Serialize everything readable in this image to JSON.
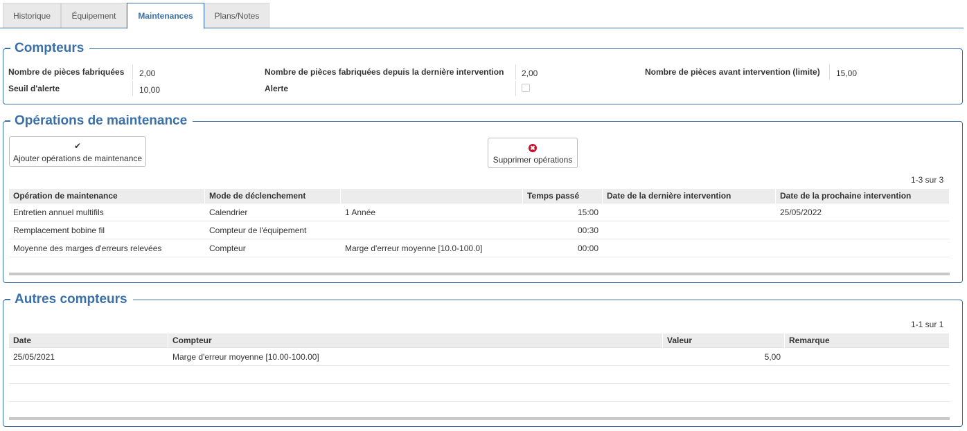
{
  "tabs": [
    {
      "label": "Historique"
    },
    {
      "label": "Équipement"
    },
    {
      "label": "Maintenances"
    },
    {
      "label": "Plans/Notes"
    }
  ],
  "compteurs": {
    "title": "Compteurs",
    "pieces_fabriquees_label": "Nombre de pièces fabriquées",
    "pieces_fabriquees_value": "2,00",
    "depuis_label": "Nombre de pièces fabriquées depuis la dernière intervention",
    "depuis_value": "2,00",
    "avant_label": "Nombre de pièces avant intervention (limite)",
    "avant_value": "15,00",
    "seuil_label": "Seuil d'alerte",
    "seuil_value": "10,00",
    "alerte_label": "Alerte",
    "alerte_checked": false
  },
  "operations": {
    "title": "Opérations de maintenance",
    "add_label": "Ajouter opérations de maintenance",
    "delete_label": "Supprimer opérations",
    "pager": "1-3 sur 3",
    "columns": [
      "Opération de maintenance",
      "Mode de déclenchement",
      "",
      "Temps passé",
      "Date de la dernière intervention",
      "Date de la prochaine intervention"
    ],
    "rows": [
      {
        "operation": "Entretien annuel multifils",
        "mode": "Calendrier",
        "detail": "1 Année",
        "temps": "15:00",
        "derniere": "",
        "prochaine": "25/05/2022"
      },
      {
        "operation": "Remplacement bobine fil",
        "mode": "Compteur de l'équipement",
        "detail": "",
        "temps": "00:30",
        "derniere": "",
        "prochaine": ""
      },
      {
        "operation": "Moyenne des marges d'erreurs relevées",
        "mode": "Compteur",
        "detail": "Marge d'erreur moyenne [10.0-100.0]",
        "temps": "00:00",
        "derniere": "",
        "prochaine": ""
      }
    ]
  },
  "autres": {
    "title": "Autres compteurs",
    "pager": "1-1 sur 1",
    "columns": [
      "Date",
      "Compteur",
      "Valeur",
      "Remarque"
    ],
    "rows": [
      {
        "date": "25/05/2021",
        "compteur": "Marge d'erreur moyenne [10.00-100.00]",
        "valeur": "5,00",
        "remarque": ""
      }
    ]
  }
}
